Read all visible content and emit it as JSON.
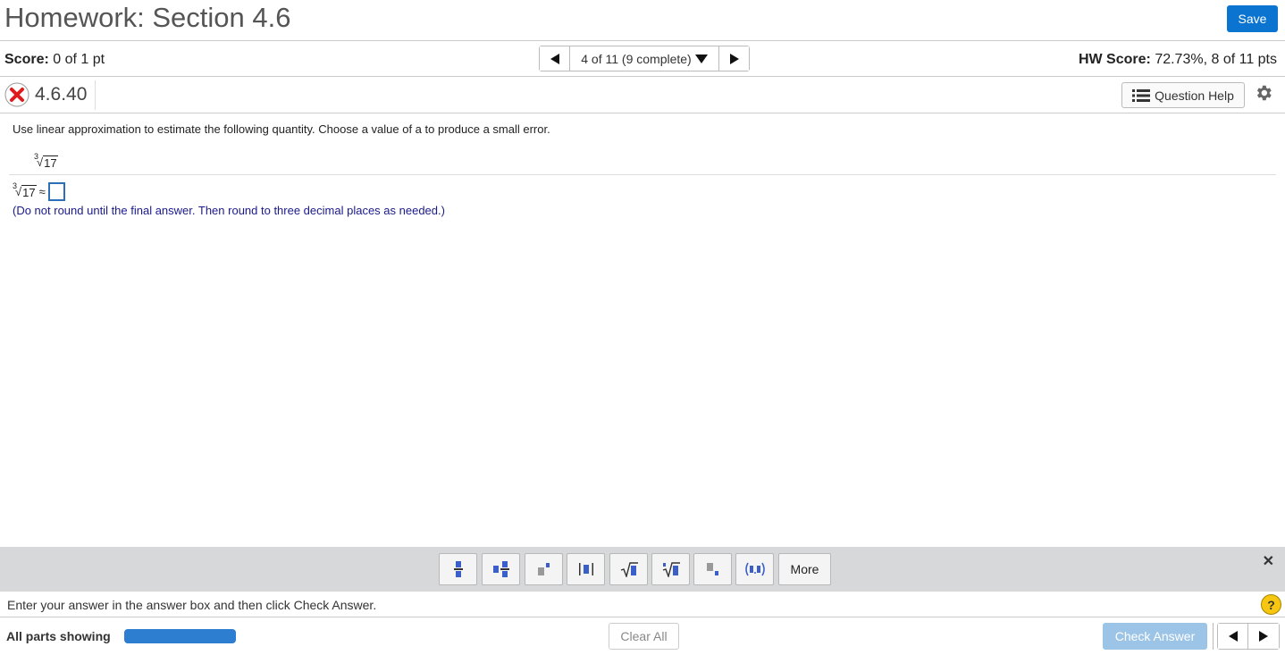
{
  "header": {
    "title": "Homework: Section 4.6",
    "save_label": "Save"
  },
  "scorebar": {
    "score_label": "Score:",
    "score_value": "0 of 1 pt",
    "nav_label": "4 of 11 (9 complete)",
    "hw_score_label": "HW Score:",
    "hw_score_value": "72.73%, 8 of 11 pts"
  },
  "question": {
    "number": "4.6.40",
    "help_label": "Question Help",
    "status": "incorrect"
  },
  "content": {
    "prompt": "Use linear approximation to estimate the following quantity. Choose a value of a to produce a small error.",
    "root_index": "3",
    "radicand": "17",
    "approx_symbol": "≈",
    "answer_value": "",
    "instruction": "(Do not round until the final answer. Then round to three decimal places as needed.)"
  },
  "toolbar": {
    "tools": [
      "fraction",
      "mixed-number",
      "exponent",
      "absolute-value",
      "square-root",
      "nth-root",
      "subscript",
      "ordered-pair"
    ],
    "more_label": "More",
    "close_symbol": "✕"
  },
  "status": {
    "message": "Enter your answer in the answer box and then click Check Answer.",
    "help_symbol": "?"
  },
  "footer": {
    "parts_label": "All parts showing",
    "progress": 1.0,
    "clear_label": "Clear All",
    "check_label": "Check Answer"
  },
  "colors": {
    "accent": "#0a74d0",
    "toolbar_bg": "#d7d8da",
    "instruction": "#1a1a8a",
    "progress": "#2d7ed0",
    "check_disabled": "#9cc4e6"
  }
}
